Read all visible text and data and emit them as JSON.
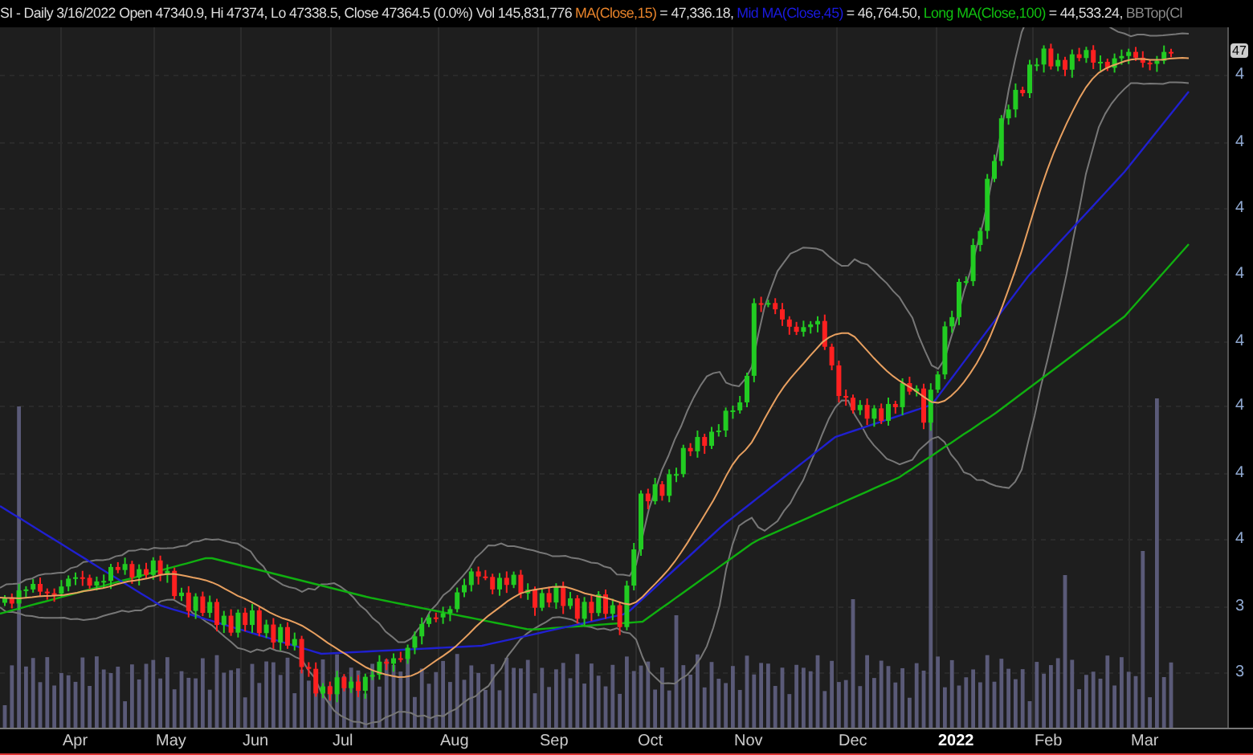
{
  "header": {
    "summary": "SI - Daily 3/16/2022 Open 47340.9, Hi 47374, Lo 47338.5, Close 47364.5 (0.0%) Vol 145,831,776",
    "indicators": [
      {
        "label": "MA(Close,15)",
        "value": "= 47,336.18,",
        "color": "#e8832a"
      },
      {
        "label": "Mid MA(Close,45)",
        "value": "= 46,764.50,",
        "color": "#1a1ae0"
      },
      {
        "label": "Long MA(Close,100)",
        "value": "= 44,533.24,",
        "color": "#10c010"
      },
      {
        "label": "BBTop(Cl",
        "color": "#8a8a8a"
      }
    ]
  },
  "price_badge": "47",
  "y_axis_labels": [
    "4",
    "4",
    "4",
    "4",
    "4",
    "4",
    "4",
    "4",
    "3",
    "3"
  ],
  "x_axis_labels": [
    {
      "label": "Apr",
      "bold": false
    },
    {
      "label": "May",
      "bold": false
    },
    {
      "label": "Jun",
      "bold": false
    },
    {
      "label": "Jul",
      "bold": false
    },
    {
      "label": "Aug",
      "bold": false
    },
    {
      "label": "Sep",
      "bold": false
    },
    {
      "label": "Oct",
      "bold": false
    },
    {
      "label": "Nov",
      "bold": false
    },
    {
      "label": "Dec",
      "bold": false
    },
    {
      "label": "2022",
      "bold": true
    },
    {
      "label": "Feb",
      "bold": false
    },
    {
      "label": "Mar",
      "bold": false
    }
  ]
}
